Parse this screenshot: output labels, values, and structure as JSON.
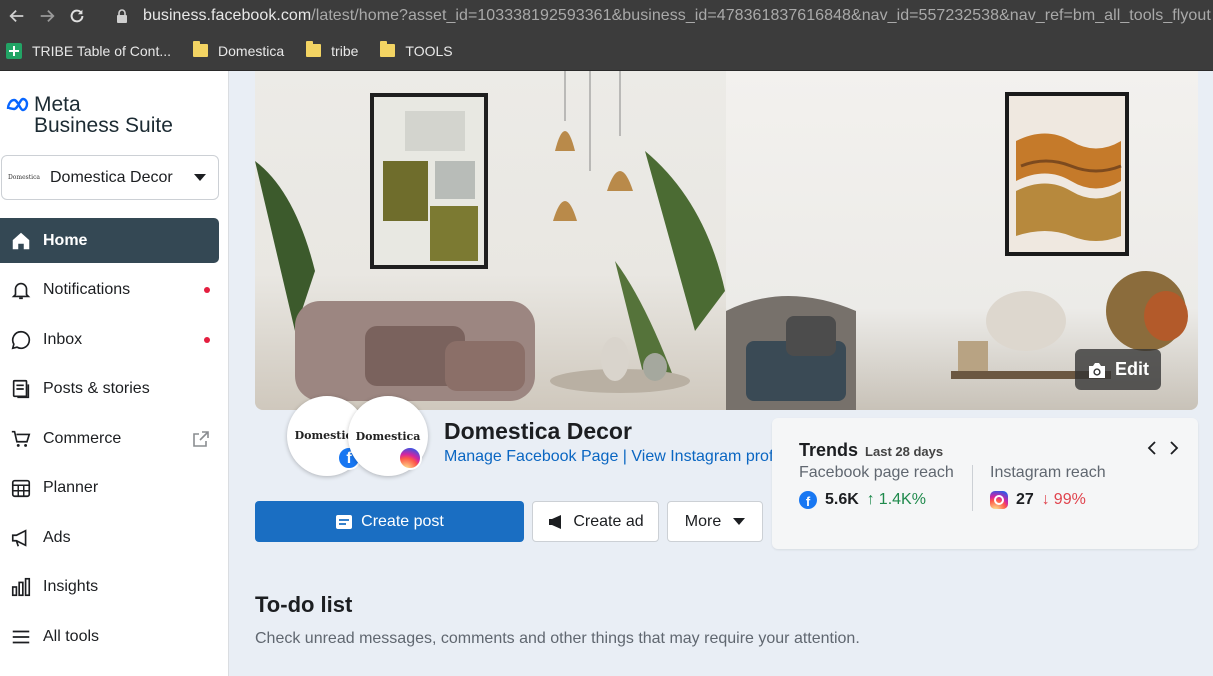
{
  "browser": {
    "url_host": "business.facebook.com",
    "url_rest": "/latest/home?asset_id=103338192593361&business_id=478361837616848&nav_id=557232538&nav_ref=bm_all_tools_flyout",
    "bookmarks": [
      {
        "label": "TRIBE Table of Cont...",
        "icon": "sheets-icon"
      },
      {
        "label": "Domestica",
        "icon": "folder-icon"
      },
      {
        "label": "tribe",
        "icon": "folder-icon"
      },
      {
        "label": "TOOLS",
        "icon": "folder-icon"
      }
    ]
  },
  "brand": {
    "line1": "Meta",
    "line2": "Business Suite"
  },
  "account": {
    "logo_text": "Domestica",
    "name": "Domestica Decor"
  },
  "nav": [
    {
      "label": "Home",
      "icon": "home-icon",
      "active": true
    },
    {
      "label": "Notifications",
      "icon": "bell-icon",
      "badge": true
    },
    {
      "label": "Inbox",
      "icon": "chat-icon",
      "badge": true
    },
    {
      "label": "Posts & stories",
      "icon": "posts-icon"
    },
    {
      "label": "Commerce",
      "icon": "cart-icon",
      "external": true
    },
    {
      "label": "Planner",
      "icon": "calendar-icon"
    },
    {
      "label": "Ads",
      "icon": "megaphone-icon"
    },
    {
      "label": "Insights",
      "icon": "bar-chart-icon"
    },
    {
      "label": "All tools",
      "icon": "menu-icon"
    }
  ],
  "cover": {
    "edit_label": "Edit"
  },
  "profile": {
    "avatar_text": "Domestica",
    "name": "Domestica Decor",
    "links": "Manage Facebook Page | View Instagram profile"
  },
  "actions": {
    "create_post": "Create post",
    "create_ad": "Create ad",
    "more": "More"
  },
  "trends": {
    "title": "Trends",
    "period": "Last 28 days",
    "fb": {
      "label": "Facebook page reach",
      "value": "5.6K",
      "change": "1.4K%"
    },
    "ig": {
      "label": "Instagram reach",
      "value": "27",
      "change": "99%"
    }
  },
  "todo": {
    "title": "To-do list",
    "subtitle": "Check unread messages, comments and other things that may require your attention."
  },
  "colors": {
    "accent": "#1a6ec2",
    "sidebar_active": "#344854",
    "up": "#1f8a4c",
    "down": "#e0434d"
  }
}
